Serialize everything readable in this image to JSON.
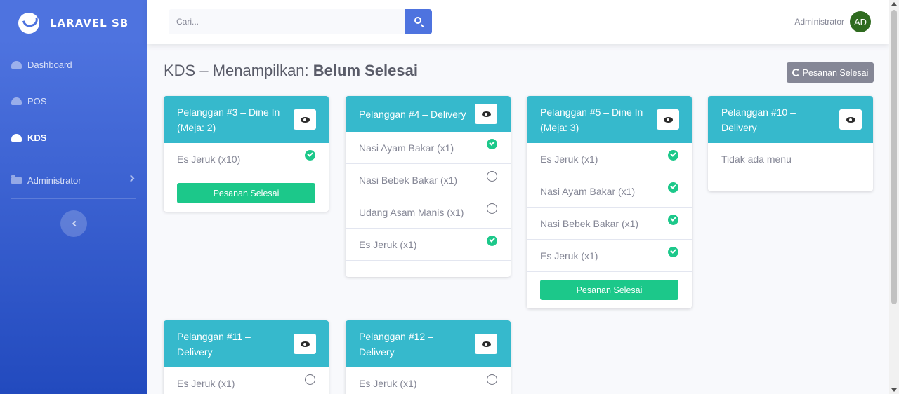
{
  "sidebar": {
    "brand": "LARAVEL SB",
    "items": [
      {
        "label": "Dashboard"
      },
      {
        "label": "POS"
      },
      {
        "label": "KDS"
      },
      {
        "label": "Administrator"
      }
    ]
  },
  "topbar": {
    "search_placeholder": "Cari...",
    "user_name": "Administrator",
    "avatar_initials": "AD"
  },
  "heading": {
    "prefix": "KDS – Menampilkan: ",
    "status": "Belum Selesai"
  },
  "toggle_button_label": "Pesanan Selesai",
  "colors": {
    "primary": "#4e73df",
    "info": "#36b9cc",
    "success": "#1cc88a",
    "secondary": "#858796"
  },
  "orders": [
    {
      "title": "Pelanggan #3 – Dine In (Meja: 2)",
      "items": [
        {
          "name": "Es Jeruk (x10)",
          "done": true
        }
      ],
      "finish_label": "Pesanan Selesai"
    },
    {
      "title": "Pelanggan #4 – Delivery",
      "items": [
        {
          "name": "Nasi Ayam Bakar (x1)",
          "done": true
        },
        {
          "name": "Nasi Bebek Bakar (x1)",
          "done": false
        },
        {
          "name": "Udang Asam Manis (x1)",
          "done": false
        },
        {
          "name": "Es Jeruk (x1)",
          "done": true
        }
      ]
    },
    {
      "title": "Pelanggan #5 – Dine In (Meja: 3)",
      "items": [
        {
          "name": "Es Jeruk (x1)",
          "done": true
        },
        {
          "name": "Nasi Ayam Bakar (x1)",
          "done": true
        },
        {
          "name": "Nasi Bebek Bakar (x1)",
          "done": true
        },
        {
          "name": "Es Jeruk (x1)",
          "done": true
        }
      ],
      "finish_label": "Pesanan Selesai"
    },
    {
      "title": "Pelanggan #10 – Delivery",
      "empty_text": "Tidak ada menu"
    },
    {
      "title": "Pelanggan #11 – Delivery",
      "items": [
        {
          "name": "Es Jeruk (x1)",
          "done": false
        }
      ]
    },
    {
      "title": "Pelanggan #12 – Delivery",
      "items": [
        {
          "name": "Es Jeruk (x1)",
          "done": false
        }
      ]
    }
  ]
}
